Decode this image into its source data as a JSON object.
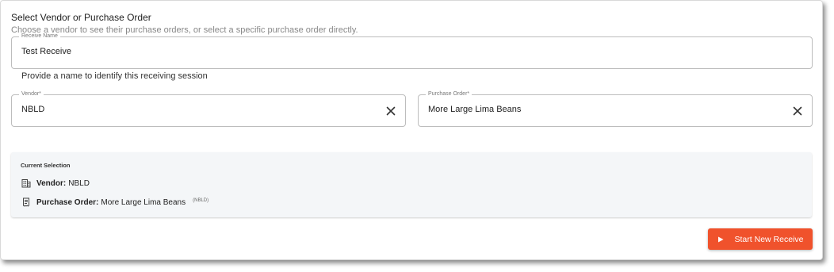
{
  "section": {
    "title": "Select Vendor or Purchase Order",
    "subtitle": "Choose a vendor to see their purchase orders, or select a specific purchase order directly."
  },
  "receive_name": {
    "label": "Receive Name",
    "value": "Test Receive",
    "helper": "Provide a name to identify this receiving session"
  },
  "vendor_field": {
    "label": "Vendor*",
    "value": "NBLD",
    "clear_icon": "close-icon"
  },
  "po_field": {
    "label": "Purchase Order*",
    "value": "More Large Lima Beans",
    "clear_icon": "close-icon"
  },
  "current_selection": {
    "title": "Current Selection",
    "vendor": {
      "icon": "building-icon",
      "label": "Vendor:",
      "value": "NBLD"
    },
    "purchase_order": {
      "icon": "receipt-icon",
      "label": "Purchase Order:",
      "value": "More Large Lima Beans",
      "tag": "(NBLD)"
    }
  },
  "actions": {
    "start_label": "Start New Receive",
    "start_icon": "play-icon"
  },
  "colors": {
    "accent": "#f0522c",
    "panel_bg": "#f4f6f8",
    "border": "#bdbdbd"
  }
}
